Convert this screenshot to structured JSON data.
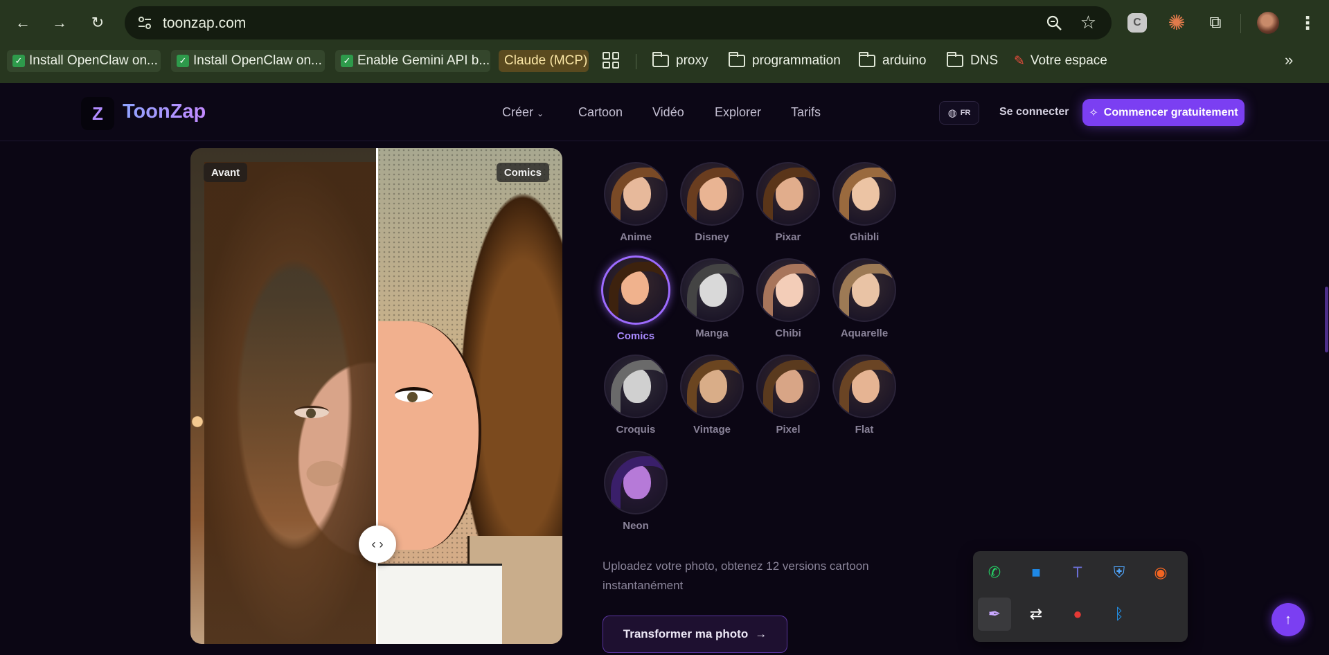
{
  "browser": {
    "url": "toonzap.com",
    "bookmarks": [
      {
        "label": "Install OpenClaw on..."
      },
      {
        "label": "Install OpenClaw on..."
      },
      {
        "label": "Enable Gemini API b..."
      },
      {
        "label": "Claude (MCP)"
      },
      {
        "label": "proxy"
      },
      {
        "label": "programmation"
      },
      {
        "label": "arduino"
      },
      {
        "label": "DNS"
      },
      {
        "label": "Votre espace"
      }
    ],
    "extension_letter": "C"
  },
  "header": {
    "logo_mark": "Z",
    "brand": "ToonZap",
    "nav": [
      "Créer",
      "Cartoon",
      "Vidéo",
      "Explorer",
      "Tarifs"
    ],
    "lang": "FR",
    "login": "Se connecter",
    "cta": "Commencer gratuitement"
  },
  "compare": {
    "before_label": "Avant",
    "after_label": "Comics",
    "slider_position": 0.5
  },
  "styles": [
    {
      "name": "Anime",
      "skin": "#e7b99b",
      "hair": "#7a4a26"
    },
    {
      "name": "Disney",
      "skin": "#e9b493",
      "hair": "#6a3d1f"
    },
    {
      "name": "Pixar",
      "skin": "#e1ad8c",
      "hair": "#5a3519"
    },
    {
      "name": "Ghibli",
      "skin": "#ecc4a4",
      "hair": "#9a6a3e"
    },
    {
      "name": "Comics",
      "skin": "#f0b28d",
      "hair": "#3d220e",
      "active": true
    },
    {
      "name": "Manga",
      "skin": "#d9d9d9",
      "hair": "#444444"
    },
    {
      "name": "Chibi",
      "skin": "#f3cdb8",
      "hair": "#a8755b"
    },
    {
      "name": "Aquarelle",
      "skin": "#e9c3a5",
      "hair": "#9d7a55"
    },
    {
      "name": "Croquis",
      "skin": "#d0d0d0",
      "hair": "#6a6a6a"
    },
    {
      "name": "Vintage",
      "skin": "#d9ad88",
      "hair": "#6b4520"
    },
    {
      "name": "Pixel",
      "skin": "#d8a586",
      "hair": "#5a3a1e"
    },
    {
      "name": "Flat",
      "skin": "#e6b493",
      "hair": "#6a4424"
    },
    {
      "name": "Neon",
      "skin": "#b67ad8",
      "hair": "#3a1f6a"
    }
  ],
  "tagline": "Uploadez votre photo, obtenez 12 versions cartoon instantanément",
  "transform_button": "Transformer ma photo",
  "tray": [
    {
      "icon": "whatsapp-icon",
      "glyph": "✆",
      "color": "#25d366"
    },
    {
      "icon": "app-blue-icon",
      "glyph": "■",
      "color": "#1e88e5"
    },
    {
      "icon": "teams-icon",
      "glyph": "T",
      "color": "#6b6fd6"
    },
    {
      "icon": "security-warning-icon",
      "glyph": "⛨",
      "color": "#4fa3f7"
    },
    {
      "icon": "avast-icon",
      "glyph": "◉",
      "color": "#f26522"
    },
    {
      "icon": "feather-icon",
      "glyph": "✒",
      "color": "#c8a7ff"
    },
    {
      "icon": "teamviewer-icon",
      "glyph": "⇄",
      "color": "#ffffff"
    },
    {
      "icon": "updater-icon",
      "glyph": "●",
      "color": "#e53935"
    },
    {
      "icon": "bluetooth-icon",
      "glyph": "ᛒ",
      "color": "#2196f3"
    }
  ]
}
